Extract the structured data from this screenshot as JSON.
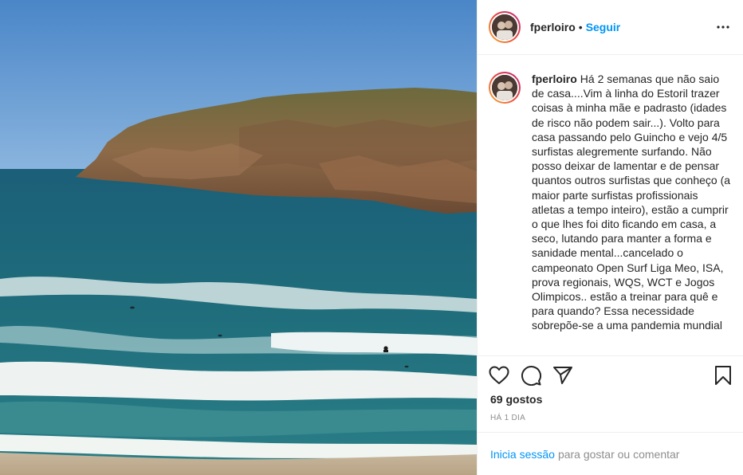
{
  "header": {
    "username": "fperloiro",
    "separator": "•",
    "follow_label": "Seguir"
  },
  "caption": {
    "username": "fperloiro",
    "text": "Há 2 semanas que não saio de casa....Vim à linha do Estoril trazer coisas à minha mãe e padrasto (idades de risco não podem sair...). Volto para casa passando pelo Guincho e vejo 4/5 surfistas alegremente surfando. Não posso deixar de lamentar e de pensar quantos outros surfistas que conheço (a maior parte surfistas profissionais atletas a tempo inteiro), estão a cumprir o que lhes foi dito ficando em casa, a seco, lutando para manter a forma e sanidade mental...cancelado o campeonato Open Surf Liga Meo, ISA, prova regionais, WQS, WCT e Jogos Olimpicos.. estão a treinar para quê e para quando? Essa necessidade sobrepõe-se a uma pandemia mundial"
  },
  "actions": {
    "like_icon": "heart-icon",
    "comment_icon": "comment-icon",
    "share_icon": "paper-plane-icon",
    "save_icon": "bookmark-icon"
  },
  "likes_text": "69 gostos",
  "timestamp_text": "HÁ 1 DIA",
  "login": {
    "link_label": "Inicia sessão",
    "rest_text": "para gostar ou comentar"
  },
  "colors": {
    "accent": "#0095f6",
    "text": "#262626",
    "muted": "#8e8e8e",
    "border": "#efefef"
  }
}
